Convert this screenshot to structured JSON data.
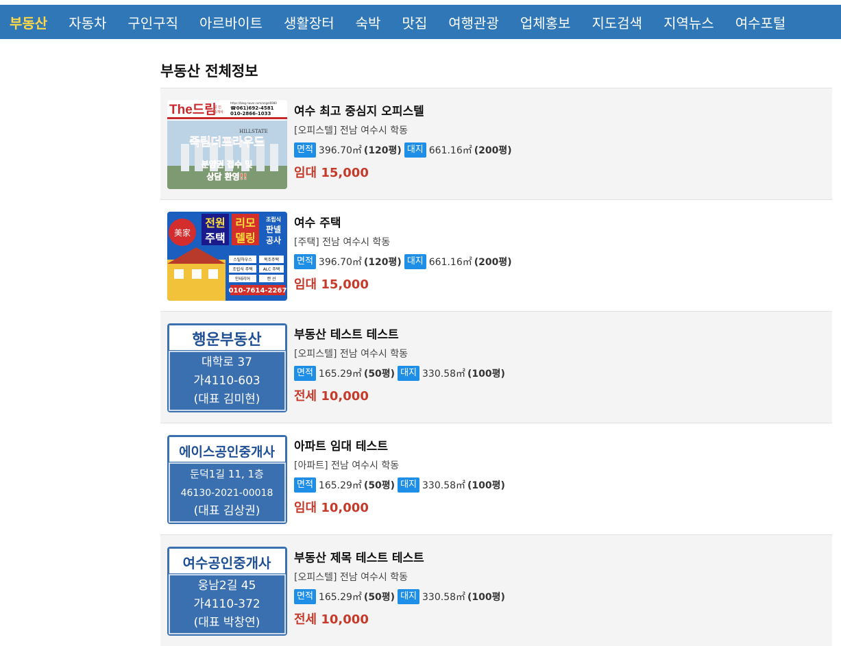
{
  "nav": {
    "items": [
      {
        "label": "부동산",
        "active": true
      },
      {
        "label": "자동차"
      },
      {
        "label": "구인구직"
      },
      {
        "label": "아르바이트"
      },
      {
        "label": "생활장터"
      },
      {
        "label": "숙박"
      },
      {
        "label": "맛집"
      },
      {
        "label": "여행관광"
      },
      {
        "label": "업체홍보"
      },
      {
        "label": "지도검색"
      },
      {
        "label": "지역뉴스"
      },
      {
        "label": "여수포털"
      }
    ]
  },
  "page_title": "부동산 전체정보",
  "size_tag_label": "면적",
  "land_tag_label": "대지",
  "listings": [
    {
      "title": "여수 최고 중심지 오피스텔",
      "category": "[오피스텔] 전남 여수시 학동",
      "size": "396.70㎡",
      "size_pyeong": "(120평)",
      "land": "661.16㎡",
      "land_pyeong": "(200평)",
      "price": "임대 15,000",
      "thumb": {
        "brand": "The드림",
        "brand_sub1": "공 인",
        "brand_sub2": "중개사",
        "phone1": "☎061)692-4581",
        "phone2": "010-2866-1033",
        "url": "https://blog.naver.com/angel6980",
        "hillstate": "HILLSTATE",
        "headline": "죽림더프라우드",
        "line1": "분양권 접수 및",
        "line2": "상담 환영!!"
      }
    },
    {
      "title": "여수 주택",
      "category": "[주택] 전남 여수시 학동",
      "size": "396.70㎡",
      "size_pyeong": "(120평)",
      "land": "661.16㎡",
      "land_pyeong": "(200평)",
      "price": "임대 15,000",
      "thumb": {
        "seal": "美家",
        "t1": "전원",
        "t2": "주택",
        "t3": "리모",
        "t4": "델링",
        "t5": "조립식",
        "t6": "판넬",
        "t7": "공사",
        "tag1": "스틸하우스",
        "tag2": "목조주택",
        "tag3": "조립식 주택",
        "tag4": "ALC 주택",
        "tag5": "인테리어",
        "tag6": "캔 선",
        "phone": "010-7614-2267"
      }
    },
    {
      "title": "부동산 테스트 테스트",
      "category": "[오피스텔] 전남 여수시 학동",
      "size": "165.29㎡",
      "size_pyeong": "(50평)",
      "land": "330.58㎡",
      "land_pyeong": "(100평)",
      "price": "전세 10,000",
      "thumb": {
        "name": "행운부동산",
        "addr": "대학로 37",
        "reg": "가4110-603",
        "rep": "(대표 김미현)"
      }
    },
    {
      "title": "아파트 임대 테스트",
      "category": "[아파트] 전남 여수시 학동",
      "size": "165.29㎡",
      "size_pyeong": "(50평)",
      "land": "330.58㎡",
      "land_pyeong": "(100평)",
      "price": "임대 10,000",
      "thumb": {
        "name": "에이스공인중개사",
        "addr": "둔덕1길 11, 1층",
        "reg": "46130-2021-00018",
        "rep": "(대표 김상권)"
      }
    },
    {
      "title": "부동산 제목 테스트 테스트",
      "category": "[오피스텔] 전남 여수시 학동",
      "size": "165.29㎡",
      "size_pyeong": "(50평)",
      "land": "330.58㎡",
      "land_pyeong": "(100평)",
      "price": "전세 10,000",
      "thumb": {
        "name": "여수공인중개사",
        "addr": "웅남2길 45",
        "reg": "가4110-372",
        "rep": "(대표 박창연)"
      }
    }
  ],
  "colors": {
    "nav_bg": "#2f77b6",
    "nav_active": "#ffd84a",
    "tag_bg": "#1f8ee6",
    "price": "#c53a2a",
    "card_blue": "#3a6fb0"
  }
}
